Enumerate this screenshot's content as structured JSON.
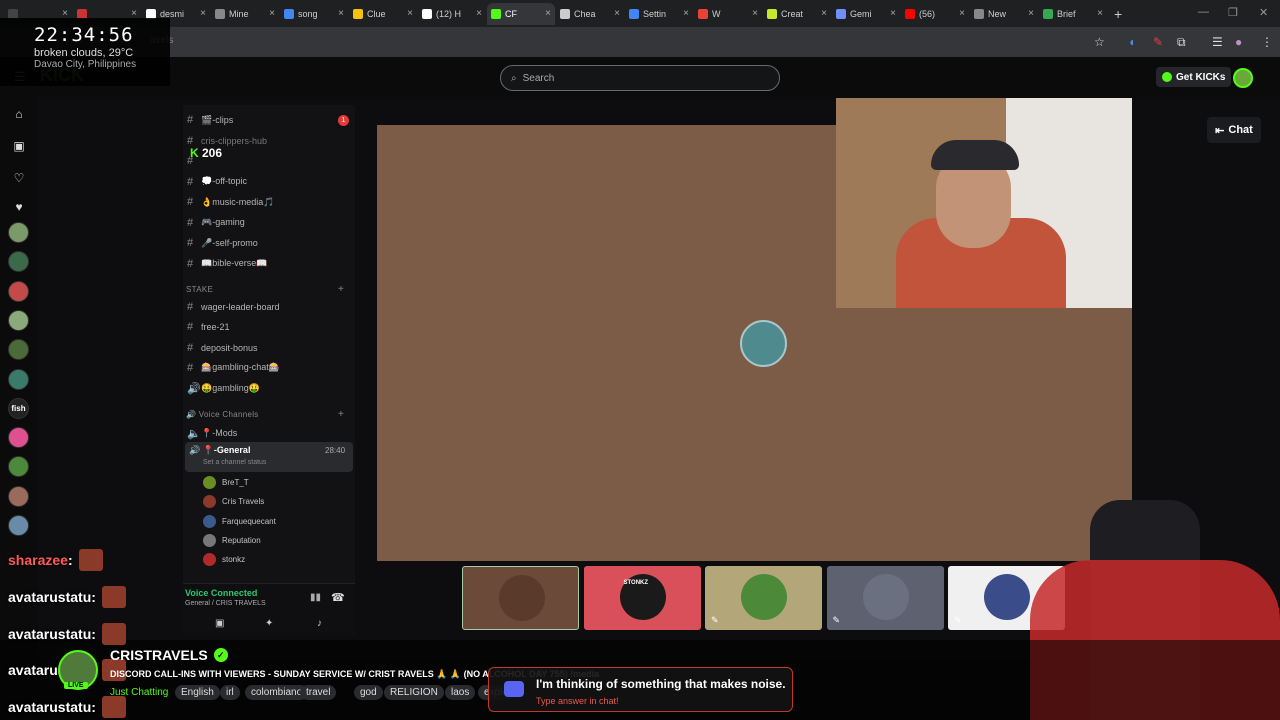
{
  "browser": {
    "tabs": [
      {
        "label": "",
        "favicon_color": "#444444",
        "active": false
      },
      {
        "label": "",
        "favicon_color": "#cc3333",
        "active": false
      },
      {
        "label": "desmi",
        "favicon_color": "#ffffff",
        "active": false
      },
      {
        "label": "Mine",
        "favicon_color": "#888888",
        "active": false
      },
      {
        "label": "song",
        "favicon_color": "#4285f4",
        "active": false
      },
      {
        "label": "Clue",
        "favicon_color": "#f4c20d",
        "active": false
      },
      {
        "label": "(12) H",
        "favicon_color": "#ffffff",
        "active": false
      },
      {
        "label": "CF",
        "favicon_color": "#53fc18",
        "active": true
      },
      {
        "label": "Chea",
        "favicon_color": "#cccccc",
        "active": false
      },
      {
        "label": "Settin",
        "favicon_color": "#4285f4",
        "active": false
      },
      {
        "label": "W",
        "favicon_color": "#ea4335",
        "active": false
      },
      {
        "label": "Creat",
        "favicon_color": "#c6e82b",
        "active": false
      },
      {
        "label": "Gemi",
        "favicon_color": "#6f8fff",
        "active": false
      },
      {
        "label": "(56)",
        "favicon_color": "#ff0000",
        "active": false
      },
      {
        "label": "New",
        "favicon_color": "#888888",
        "active": false
      },
      {
        "label": "Brief",
        "favicon_color": "#34a853",
        "active": false
      }
    ],
    "new_tab": "+",
    "close_glyph": "×",
    "url": "avels"
  },
  "clock": {
    "time": "22:34:56",
    "weather": "broken clouds, 29°C",
    "location": "Davao City, Philippines"
  },
  "kick": {
    "search_placeholder": "Search",
    "get_kicks": "Get KICKs",
    "chat_button": "Chat",
    "viewer_count": "206"
  },
  "discord": {
    "channels": [
      {
        "name": "🎬-clips",
        "badge": "1"
      },
      {
        "name": "cris-clippers-hub",
        "badge": ""
      },
      {
        "name": "",
        "badge": ""
      },
      {
        "name": "💭-off-topic",
        "badge": ""
      },
      {
        "name": "👌music-media🎵",
        "badge": ""
      },
      {
        "name": "🎮-gaming",
        "badge": ""
      },
      {
        "name": "🎤-self-promo",
        "badge": ""
      },
      {
        "name": "📖bible-verse📖",
        "badge": ""
      }
    ],
    "stake_category": "STAKE",
    "stake_channels": [
      {
        "name": "wager-leader-board",
        "icon": "#"
      },
      {
        "name": "free-21",
        "icon": "#"
      },
      {
        "name": "deposit-bonus",
        "icon": "#"
      },
      {
        "name": "🎰gambling-chat🎰",
        "icon": "#"
      },
      {
        "name": "🤑gambling🤑",
        "icon": "🔊"
      }
    ],
    "voice_category": "Voice Channels",
    "voice_channels": [
      {
        "name": "📍-Mods"
      },
      {
        "name": "📍-General",
        "time": "28:40",
        "status": "Set a channel status"
      }
    ],
    "voice_users": [
      {
        "name": "BreT_T",
        "color": "#6b8e23"
      },
      {
        "name": "Cris Travels",
        "color": "#8b3a2a"
      },
      {
        "name": "Farquequecant",
        "color": "#3a5a8b"
      },
      {
        "name": "Reputation",
        "color": "#777777"
      },
      {
        "name": "stonkz",
        "color": "#b02a2a"
      }
    ],
    "voice_connected": "Voice Connected",
    "voice_connected_sub": "General / CRIS TRAVELS"
  },
  "call_thumbs": [
    {
      "label": "",
      "bg": "#6b4a3a",
      "avatar": "#5a3a2a"
    },
    {
      "label": "STONKZ",
      "bg": "#d9505a",
      "avatar": "#1a1a1a"
    },
    {
      "label": "",
      "bg": "#b3a77a",
      "avatar": "#4c8a3a"
    },
    {
      "label": "",
      "bg": "#5e6170",
      "avatar": "#6a7080"
    },
    {
      "label": "",
      "bg": "#f0f0f0",
      "avatar": "#3a4c8a"
    }
  ],
  "chat_overlay": [
    {
      "user": "sharazee",
      "color": "#ff5a5a"
    },
    {
      "user": "avatarustatu",
      "color": "#ffffff"
    },
    {
      "user": "avatarustatu",
      "color": "#ffffff"
    },
    {
      "user": "avatarustatu",
      "color": "#ffffff"
    },
    {
      "user": "avatarustatu",
      "color": "#ffffff"
    }
  ],
  "stream": {
    "channel_name": "CRISTRAVELS",
    "live_badge": "LIVE",
    "title": "DISCORD CALL-INS WITH VIEWERS - SUNDAY SERVICE W/ CRIST RAVELS 🙏 🙏 (NO ALCOHOL DAY 755) !media",
    "category": "Just Chatting",
    "tags": [
      "English",
      "irl",
      "colombiano",
      "travel",
      "god",
      "RELIGION",
      "laos",
      "explo"
    ]
  },
  "quiz": {
    "question": "I'm thinking of something that makes noise.",
    "subtitle": "Type answer in chat!"
  }
}
